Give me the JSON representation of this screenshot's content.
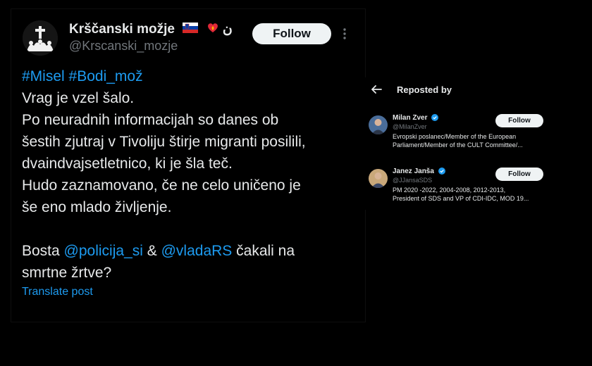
{
  "post": {
    "author_name": "Krščanski možje",
    "author_emoji_text": "ن",
    "author_handle": "@Krscanski_mozje",
    "follow_label": "Follow",
    "hashtag_1": "#Misel",
    "hashtag_2": "#Bodi_mož",
    "lines": [
      "Vrag je vzel šalo.",
      "Po neuradnih informacijah so danes ob",
      "šestih zjutraj v Tivoliju štirje migranti posilili,",
      "dvaindvajsetletnico, ki je šla teč.",
      "Hudo zaznamovano, če ne celo uničeno je",
      "še eno mlado življenje."
    ],
    "closing_prefix": "Bosta ",
    "mention_1": "@policija_si",
    "closing_amp": " & ",
    "mention_2": "@vladaRS",
    "closing_suffix": " čakali na",
    "closing_line_2": "smrtne žrtve?",
    "translate_label": "Translate post"
  },
  "reposted_panel": {
    "title": "Reposted by",
    "users": [
      {
        "name": "Milan Zver",
        "handle": "@MilanZver",
        "bio_1": "Evropski poslanec/Member of the European",
        "bio_2": "Parliament/Member of the CULT Committee/...",
        "follow_label": "Follow"
      },
      {
        "name": "Janez Janša",
        "handle": "@JJansaSDS",
        "bio_1": "PM 2020 -2022, 2004-2008, 2012-2013,",
        "bio_2": "President of SDS and VP of CDI-IDC, MOD 19...",
        "follow_label": "Follow"
      }
    ]
  },
  "colors": {
    "background": "#000000",
    "text": "#e7e9ea",
    "secondary_text": "#71767b",
    "link": "#1d9bf0",
    "button_bg": "#eff3f4",
    "verified": "#1d9bf0"
  },
  "icons": [
    "cross-avatar-icon",
    "slovenia-flag-icon",
    "heart-on-fire-icon",
    "more-icon",
    "back-arrow-icon",
    "verified-badge-icon"
  ]
}
